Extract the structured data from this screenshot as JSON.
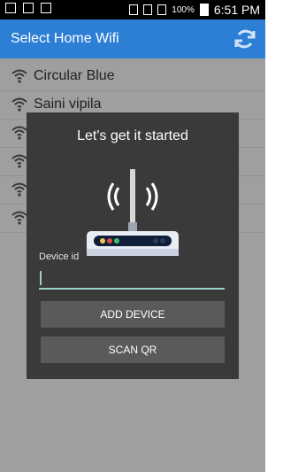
{
  "status": {
    "battery": "100%",
    "time": "6:51 PM"
  },
  "app": {
    "title": "Select Home Wifi"
  },
  "networks": [
    "Circular Blue",
    "Saini vipila",
    "",
    "",
    "",
    ""
  ],
  "dialog": {
    "title": "Let's get it started",
    "device_label": "Device id",
    "device_value": "",
    "add_button": "ADD DEVICE",
    "scan_button": "SCAN QR"
  },
  "colors": {
    "appbar": "#2d7fd5",
    "accent": "#9ad2c8",
    "dialog": "#3a3a3a",
    "button": "#5a5a5a"
  }
}
